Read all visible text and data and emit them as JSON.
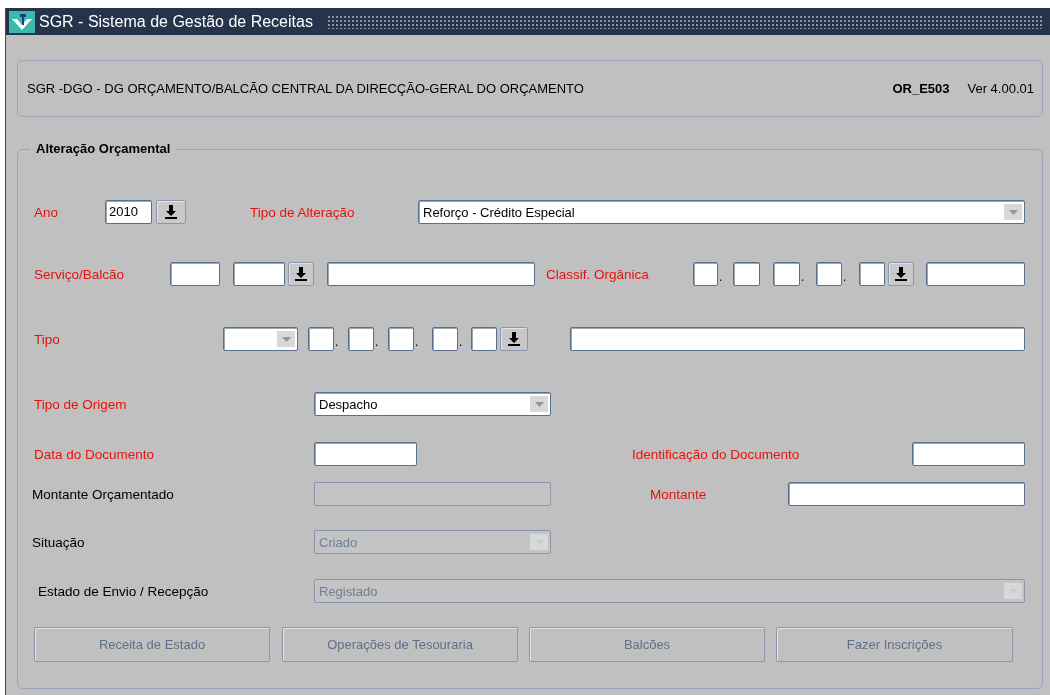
{
  "window": {
    "title": "SGR - Sistema de Gestão de Receitas"
  },
  "header": {
    "organization": "SGR -DGO - DG ORÇAMENTO/BALCÃO CENTRAL DA DIRECÇÃO-GERAL DO ORÇAMENTO",
    "form_code": "OR_E503",
    "version": "Ver 4.00.01"
  },
  "section": {
    "title": "Alteração Orçamental"
  },
  "rows": [
    {
      "items": [
        {
          "kind": "label",
          "text": "Ano",
          "required": true
        },
        {
          "kind": "field",
          "value": "2010",
          "disabled": false
        },
        {
          "kind": "lov"
        },
        {
          "kind": "label",
          "text": "Tipo de Alteração",
          "required": true
        },
        {
          "kind": "select",
          "value": "Reforço - Crédito Especial",
          "disabled": false
        }
      ]
    },
    {
      "items": [
        {
          "kind": "label",
          "text": "Serviço/Balcão",
          "required": true
        },
        {
          "kind": "field",
          "disabled": false
        },
        {
          "kind": "field",
          "disabled": false
        },
        {
          "kind": "lov"
        },
        {
          "kind": "field",
          "disabled": false
        },
        {
          "kind": "label",
          "text": "Classif. Orgânica",
          "required": true
        },
        {
          "kind": "field",
          "disabled": false
        },
        {
          "kind": "separator",
          "text": "."
        },
        {
          "kind": "field",
          "disabled": false
        },
        {
          "kind": "field",
          "disabled": false
        },
        {
          "kind": "separator",
          "text": "."
        },
        {
          "kind": "field",
          "disabled": false
        },
        {
          "kind": "separator",
          "text": "."
        },
        {
          "kind": "field",
          "disabled": false
        },
        {
          "kind": "lov"
        },
        {
          "kind": "field",
          "disabled": false
        }
      ]
    },
    {
      "items": [
        {
          "kind": "label",
          "text": "Tipo",
          "required": true
        },
        {
          "kind": "select",
          "disabled": false
        },
        {
          "kind": "field",
          "disabled": false
        },
        {
          "kind": "separator",
          "text": "."
        },
        {
          "kind": "field",
          "disabled": false
        },
        {
          "kind": "separator",
          "text": "."
        },
        {
          "kind": "field",
          "disabled": false
        },
        {
          "kind": "separator",
          "text": "."
        },
        {
          "kind": "field",
          "disabled": false
        },
        {
          "kind": "separator",
          "text": "."
        },
        {
          "kind": "field",
          "disabled": false
        },
        {
          "kind": "lov"
        },
        {
          "kind": "field",
          "disabled": false
        }
      ]
    },
    {
      "items": [
        {
          "kind": "label",
          "text": "Tipo de Origem",
          "required": true
        },
        {
          "kind": "select",
          "value": "Despacho",
          "disabled": false
        }
      ]
    },
    {
      "items": [
        {
          "kind": "label",
          "text": "Data do Documento",
          "required": true
        },
        {
          "kind": "field",
          "disabled": false
        },
        {
          "kind": "label",
          "text": "Identificação do Documento",
          "required": true
        },
        {
          "kind": "field",
          "disabled": false
        }
      ]
    },
    {
      "items": [
        {
          "kind": "label",
          "text": "Montante Orçamentado",
          "required": false
        },
        {
          "kind": "field",
          "disabled": true
        },
        {
          "kind": "label",
          "text": "Montante",
          "required": true
        },
        {
          "kind": "field",
          "disabled": false
        }
      ]
    },
    {
      "items": [
        {
          "kind": "label",
          "text": "Situação",
          "required": false
        },
        {
          "kind": "select",
          "value": "Criado",
          "disabled": true
        }
      ]
    },
    {
      "items": [
        {
          "kind": "label",
          "text": "Estado de Envio / Recepção",
          "required": false
        },
        {
          "kind": "select",
          "value": "Registado",
          "disabled": true
        }
      ]
    }
  ],
  "buttons": [
    {
      "label": "Receita de Estado",
      "disabled": true
    },
    {
      "label": "Operações de Tesouraria",
      "disabled": true
    },
    {
      "label": "Balcões",
      "disabled": true
    },
    {
      "label": "Fazer Inscrições",
      "disabled": true
    }
  ]
}
